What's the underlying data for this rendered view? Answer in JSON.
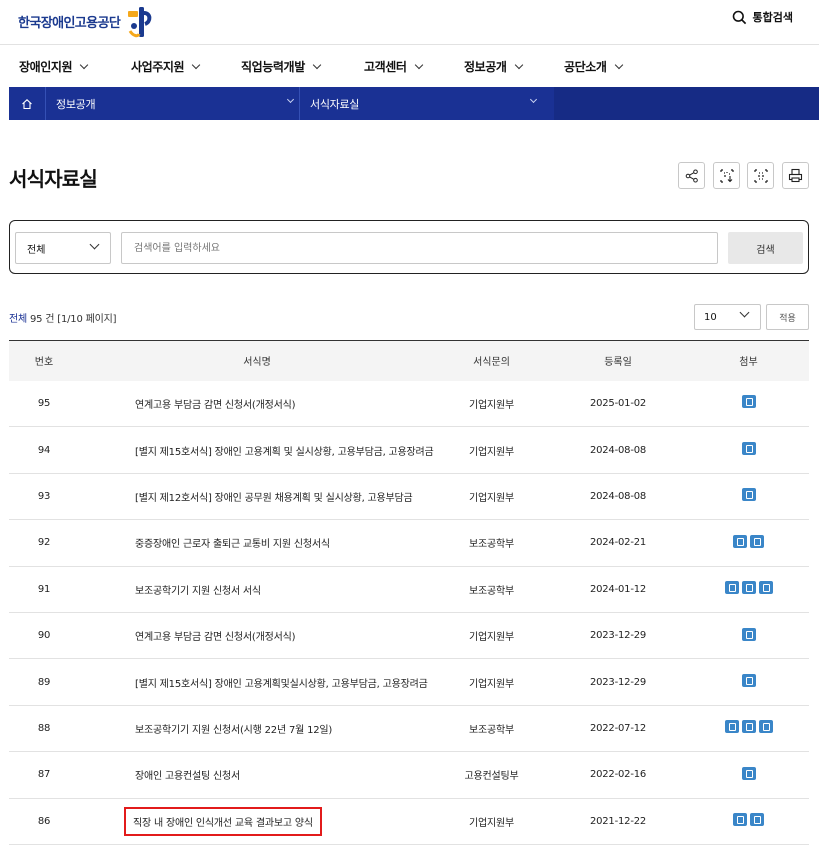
{
  "header": {
    "logo_text": "한국장애인고용공단",
    "total_search_label": "통합검색"
  },
  "nav": [
    {
      "label": "장애인지원"
    },
    {
      "label": "사업주지원"
    },
    {
      "label": "직업능력개발"
    },
    {
      "label": "고객센터"
    },
    {
      "label": "정보공개"
    },
    {
      "label": "공단소개"
    }
  ],
  "breadcrumb": {
    "level1": "정보공개",
    "level2": "서식자료실"
  },
  "page": {
    "title": "서식자료실"
  },
  "search": {
    "category": "전체",
    "placeholder": "검색어를 입력하세요",
    "button": "검색"
  },
  "list_info": {
    "all_label": "전체",
    "count_text": " 95 건 [1/10 페이지]",
    "page_size": "10",
    "apply_label": "적용"
  },
  "table": {
    "headers": [
      "번호",
      "서식명",
      "서식문의",
      "등록일",
      "첨부"
    ],
    "rows": [
      {
        "no": "95",
        "title": "연계고용 부담금 감면 신청서(개정서식)",
        "dept": "기업지원부",
        "date": "2025-01-02",
        "files": 1
      },
      {
        "no": "94",
        "title": "[별지 제15호서식] 장애인 고용계획 및 실시상황, 고용부담금, 고용장려금",
        "dept": "기업지원부",
        "date": "2024-08-08",
        "files": 1
      },
      {
        "no": "93",
        "title": "[별지 제12호서식] 장애인 공무원 채용계획 및 실시상황, 고용부담금",
        "dept": "기업지원부",
        "date": "2024-08-08",
        "files": 1
      },
      {
        "no": "92",
        "title": "중증장애인 근로자 출퇴근 교통비 지원 신청서식",
        "dept": "보조공학부",
        "date": "2024-02-21",
        "files": 2
      },
      {
        "no": "91",
        "title": "보조공학기기 지원 신청서 서식",
        "dept": "보조공학부",
        "date": "2024-01-12",
        "files": 3
      },
      {
        "no": "90",
        "title": "연계고용 부담금 감면 신청서(개정서식)",
        "dept": "기업지원부",
        "date": "2023-12-29",
        "files": 1
      },
      {
        "no": "89",
        "title": "[별지 제15호서식] 장애인 고용계획및실시상황, 고용부담금, 고용장려금",
        "dept": "기업지원부",
        "date": "2023-12-29",
        "files": 1
      },
      {
        "no": "88",
        "title": "보조공학기기 지원 신청서(시행 22년 7월 12일)",
        "dept": "보조공학부",
        "date": "2022-07-12",
        "files": 3
      },
      {
        "no": "87",
        "title": "장애인 고용컨설팅 신청서",
        "dept": "고용컨설팅부",
        "date": "2022-02-16",
        "files": 1
      },
      {
        "no": "86",
        "title": "직장 내 장애인 인식개선 교육 결과보고 양식",
        "dept": "기업지원부",
        "date": "2021-12-22",
        "files": 2,
        "highlighted": true
      }
    ]
  },
  "colors": {
    "brand_navy": "#1a3194",
    "highlight_red": "#e21b1b",
    "file_icon_blue": "#3a86c8"
  },
  "icons": [
    "search-icon",
    "home-icon",
    "share-icon",
    "download-icon",
    "qr-icon",
    "print-icon",
    "file-icon"
  ]
}
